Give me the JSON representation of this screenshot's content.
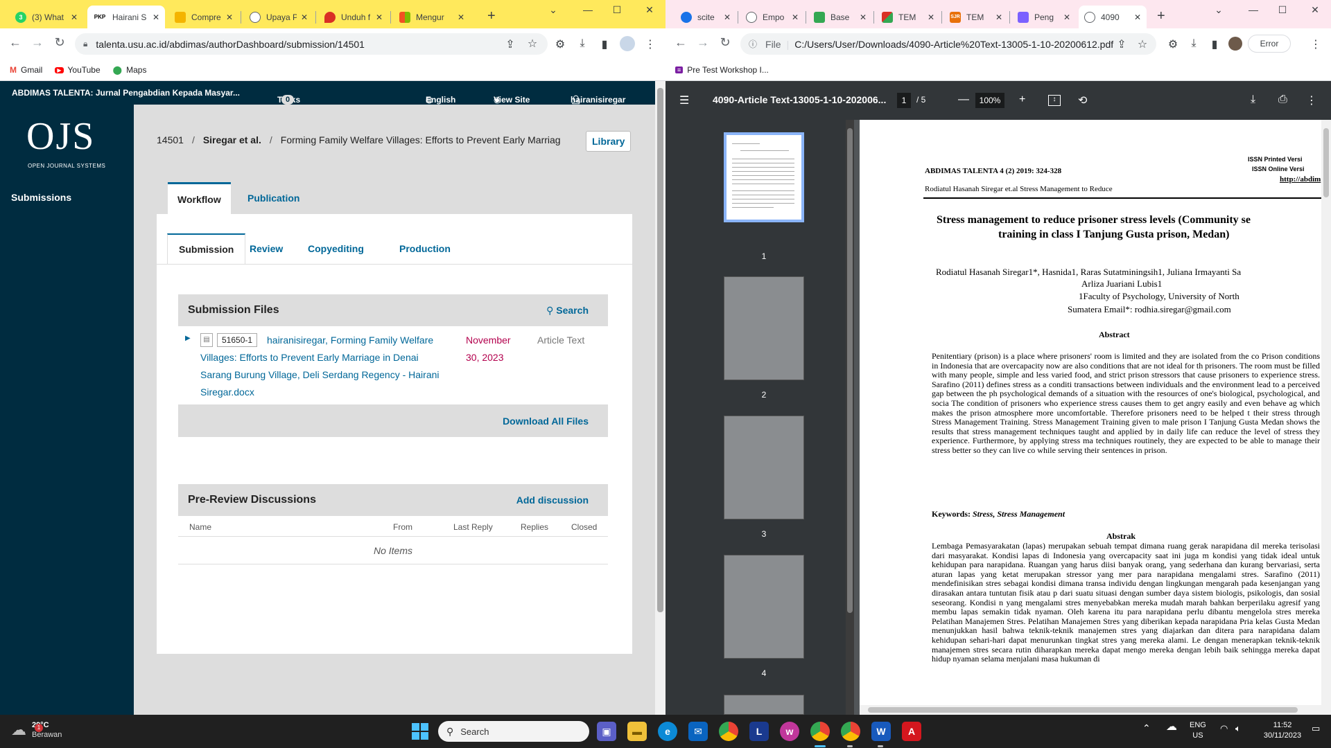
{
  "left_browser": {
    "tabs": [
      {
        "label": "(3) What",
        "fav": "3",
        "color": "#25d366"
      },
      {
        "label": "Hairani S",
        "fav": "PKP",
        "color": "#ffffff",
        "active": true
      },
      {
        "label": "Compre",
        "fav": "",
        "color": "#f4b400"
      },
      {
        "label": "Upaya P",
        "fav": "",
        "color": "#5f6368"
      },
      {
        "label": "Unduh f",
        "fav": "",
        "color": "#d93025"
      },
      {
        "label": "Mengur",
        "fav": "",
        "color": "#7cbb00"
      }
    ],
    "url": "talenta.usu.ac.id/abdimas/authorDashboard/submission/14501",
    "bookmarks": [
      "Gmail",
      "YouTube",
      "Maps"
    ]
  },
  "ojs": {
    "journal_title": "ABDIMAS TALENTA: Jurnal Pengabdian Kepada Masyar...",
    "tasks_label": "Tasks",
    "tasks_count": "0",
    "language": "English",
    "view_site": "View Site",
    "username": "hairanisiregar",
    "logo": "OJS",
    "logo_sub": "OPEN JOURNAL SYSTEMS",
    "nav_submissions": "Submissions",
    "breadcrumb": {
      "id": "14501",
      "authors": "Siregar et al.",
      "title": "Forming Family Welfare Villages: Efforts to Prevent Early Marriag"
    },
    "library_label": "Library",
    "main_tabs": [
      "Workflow",
      "Publication"
    ],
    "stage_tabs": [
      "Submission",
      "Review",
      "Copyediting",
      "Production"
    ],
    "submission_files": {
      "title": "Submission Files",
      "search_label": "Search",
      "file": {
        "id": "51650-1",
        "name": "hairanisiregar, Forming Family Welfare Villages: Efforts to Prevent Early Marriage in Denai Sarang Burung Village, Deli Serdang Regency - Hairani Siregar.docx",
        "date": "November 30, 2023",
        "type": "Article Text"
      },
      "download_all": "Download All Files"
    },
    "discussions": {
      "title": "Pre-Review Discussions",
      "add_label": "Add discussion",
      "columns": [
        "Name",
        "From",
        "Last Reply",
        "Replies",
        "Closed"
      ],
      "empty": "No Items"
    }
  },
  "right_browser": {
    "tabs": [
      {
        "label": "scite",
        "color": "#1a73e8"
      },
      {
        "label": "Empo",
        "color": "#5f6368"
      },
      {
        "label": "Base",
        "color": "#34a853"
      },
      {
        "label": "TEM",
        "color": "#d93025"
      },
      {
        "label": "TEM",
        "color": "#e8710a"
      },
      {
        "label": "Peng",
        "color": "#7b61ff"
      },
      {
        "label": "4090",
        "color": "#5f6368",
        "active": true
      }
    ],
    "url_prefix": "File",
    "url": "C:/Users/User/Downloads/4090-Article%20Text-13005-1-10-20200612.pdf",
    "error_label": "Error",
    "bookmark": "Pre Test Workshop I..."
  },
  "pdf": {
    "filename": "4090-Article Text-13005-1-10-202006...",
    "page": "1",
    "total": "5",
    "zoom": "100%",
    "thumb_numbers": [
      "1",
      "2",
      "3",
      "4"
    ],
    "header_left": "ABDIMAS TALENTA 4 (2) 2019: 324-328",
    "issn_print": "ISSN Printed Versi",
    "issn_online": "ISSN Online Versi",
    "url_fragment": "http://abdim",
    "running_head": "Rodiatul Hasanah Siregar et.al Stress Management to Reduce",
    "title1": "Stress management to reduce prisoner stress levels (Community se",
    "title2": "training in class I Tanjung Gusta prison, Medan)",
    "authors1": "Rodiatul Hasanah Siregar1*, Hasnida1, Raras Sutatminingsih1, Juliana Irmayanti Sa",
    "authors2": "Arliza Juariani Lubis1",
    "affil": "1Faculty of Psychology, University of North",
    "email": "Sumatera Email*: rodhia.siregar@gmail.com",
    "abstract_h": "Abstract",
    "abstract": "Penitentiary (prison) is a place where prisoners' room is limited and they are isolated from the co Prison conditions in Indonesia that are overcapacity now are also conditions that are not ideal for th prisoners. The room must be filled with many people, simple and less varied food, and strict prison stressors that cause prisoners to experience stress. Sarafino (2011) defines stress as a conditi transactions between individuals and the environment lead to a perceived gap between the ph psychological demands of a situation with the resources of one's biological, psychological, and socia The condition of prisoners who experience stress causes them to get angry easily and even behave ag which makes the prison atmosphere more uncomfortable. Therefore prisoners need to be helped t their stress through Stress Management Training. Stress Management Training given to male prison I Tanjung Gusta Medan shows the results that stress management techniques taught and applied by in daily life can reduce the level of stress they experience. Furthermore, by applying stress ma techniques routinely, they are expected to be able to manage their stress better so they can live co while serving their sentences in prison.",
    "keywords_label": "Keywords:",
    "keywords": "Stress, Stress Management",
    "abstrak_h": "Abstrak",
    "abstrak": "Lembaga Pemasyarakatan (lapas) merupakan sebuah tempat dimana ruang gerak narapidana dil mereka terisolasi dari masyarakat. Kondisi lapas di Indonesia yang overcapacity saat ini juga m kondisi yang tidak ideal untuk kehidupan para narapidana. Ruangan yang harus diisi banyak orang, yang sederhana dan kurang bervariasi, serta aturan lapas yang ketat merupakan stressor yang mer para narapidana mengalami stres. Sarafino (2011) mendefinisikan stres sebagai kondisi dimana transa individu dengan lingkungan mengarah pada kesenjangan yang dirasakan antara tuntutan fisik atau p dari suatu situasi dengan sumber daya sistem biologis, psikologis, dan sosial seseorang. Kondisi n yang mengalami stres menyebabkan mereka mudah marah bahkan berperilaku agresif yang membu lapas semakin tidak nyaman. Oleh karena itu para narapidana perlu dibantu mengelola stres mereka Pelatihan Manajemen Stres. Pelatihan Manajemen Stres yang diberikan kepada narapidana Pria kelas Gusta Medan menunjukkan hasil bahwa teknik-teknik manajemen stres yang diajarkan dan ditera para narapidana dalam kehidupan sehari-hari dapat menurunkan tingkat stres yang mereka alami. Le dengan menerapkan teknik-teknik manajemen stres secara rutin diharapkan mereka dapat mengo mereka dengan lebih baik sehingga mereka dapat hidup nyaman selama menjalani masa hukuman di"
  },
  "taskbar": {
    "temp": "29°C",
    "weather": "Berawan",
    "weather_badge": "1",
    "search_label": "Search",
    "lang1": "ENG",
    "lang2": "US",
    "time": "11:52",
    "date": "30/11/2023"
  }
}
